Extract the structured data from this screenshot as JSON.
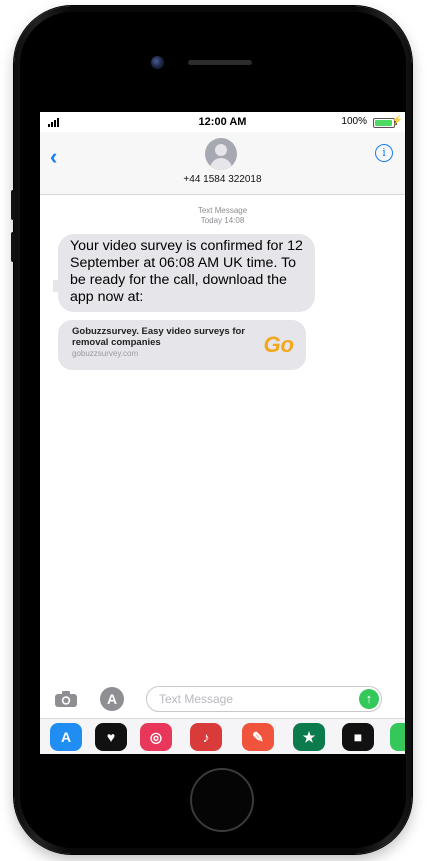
{
  "status_bar": {
    "time": "12:00 AM",
    "battery_percent": "100%",
    "charging_glyph": "⚡",
    "signal_icon": "signal-bars-icon"
  },
  "header": {
    "back_icon": "chevron-left-icon",
    "back_glyph": "‹",
    "avatar_icon": "contact-avatar-icon",
    "contact_number": "+44 1584 322018",
    "info_icon": "info-icon",
    "info_glyph": "i"
  },
  "conversation": {
    "meta_type": "Text Message",
    "meta_time": "Today 14:08",
    "messages": [
      {
        "text": "Your video survey is confirmed for 12 September at 06:08 AM UK time. To be ready for the call, download the app now at:"
      }
    ],
    "link_preview": {
      "title": "Gobuzzsurvey. Easy video surveys for removal companies",
      "url": "gobuzzsurvey.com",
      "logo_text": "Go"
    }
  },
  "compose": {
    "camera_icon": "camera-icon",
    "appstore_icon": "app-store-icon",
    "appstore_glyph": "A",
    "placeholder": "Text Message",
    "send_icon": "send-arrow-icon",
    "send_glyph": "↑"
  },
  "app_drawer": {
    "apps": [
      {
        "name": "app-store-icon",
        "glyph": "A",
        "color": "#1f8df2"
      },
      {
        "name": "digital-touch-icon",
        "glyph": "♥",
        "color": "#111111"
      },
      {
        "name": "image-search-icon",
        "glyph": "◎",
        "color": "#e8375b"
      },
      {
        "name": "music-app-icon",
        "glyph": "♪",
        "color": "#d93a3a"
      },
      {
        "name": "paint-app-icon",
        "glyph": "✎",
        "color": "#f0543c"
      },
      {
        "name": "starbucks-app-icon",
        "glyph": "★",
        "color": "#0b7a4d"
      },
      {
        "name": "notes-app-icon",
        "glyph": "■",
        "color": "#111111"
      },
      {
        "name": "green-app-icon",
        "glyph": "",
        "color": "#34c759"
      }
    ]
  },
  "colors": {
    "ios_blue": "#1a7cf5",
    "bubble_gray": "#e5e5ea",
    "send_green": "#34c759",
    "logo_orange": "#f4a61c"
  }
}
